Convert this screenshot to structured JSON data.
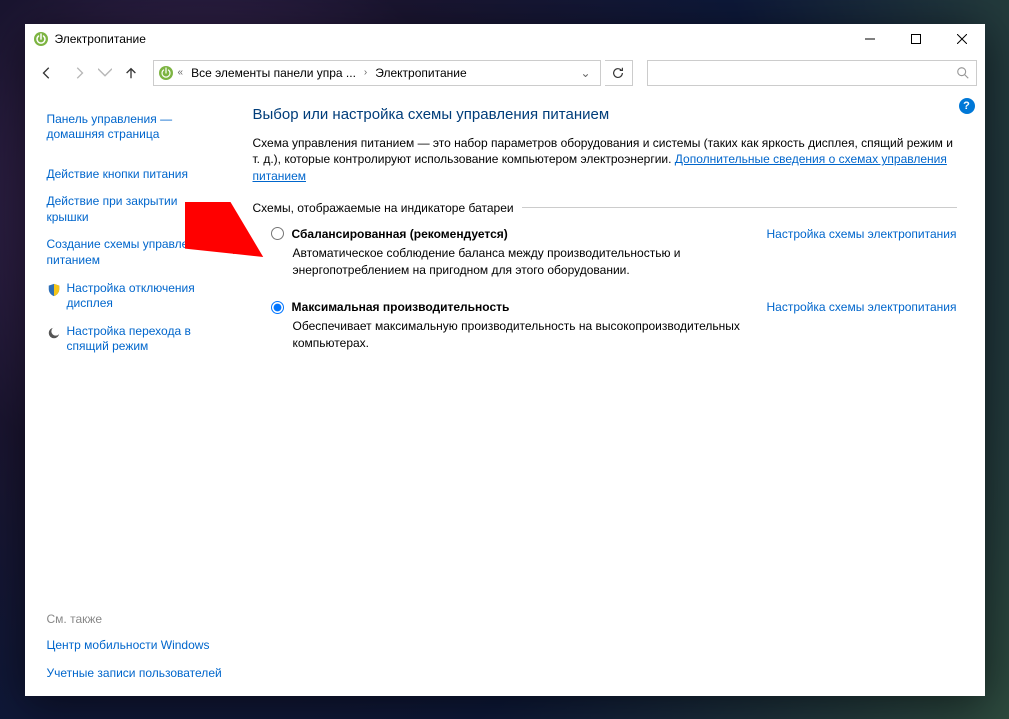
{
  "window": {
    "title": "Электропитание"
  },
  "breadcrumb": {
    "root": "Все элементы панели упра ...",
    "current": "Электропитание"
  },
  "search": {
    "placeholder": ""
  },
  "sidebar": {
    "home": "Панель управления — домашняя страница",
    "items": [
      "Действие кнопки питания",
      "Действие при закрытии крышки",
      "Создание схемы управления питанием",
      "Настройка отключения дисплея",
      "Настройка перехода в спящий режим"
    ],
    "see_also_header": "См. также",
    "see_also": [
      "Центр мобильности Windows",
      "Учетные записи пользователей"
    ]
  },
  "main": {
    "heading": "Выбор или настройка схемы управления питанием",
    "intro": "Схема управления питанием — это набор параметров оборудования и системы (таких как яркость дисплея, спящий режим и т. д.), которые контролируют использование компьютером электроэнергии. ",
    "intro_link": "Дополнительные сведения о схемах управления питанием",
    "fieldset": "Схемы, отображаемые на индикаторе батареи",
    "plans": [
      {
        "label": "Сбалансированная (рекомендуется)",
        "desc": "Автоматическое соблюдение баланса между производительностью и энергопотреблением на пригодном для этого оборудовании.",
        "settings_link": "Настройка схемы электропитания",
        "checked": false
      },
      {
        "label": "Максимальная производительность",
        "desc": "Обеспечивает максимальную производительность на высокопроизводительных компьютерах.",
        "settings_link": "Настройка схемы электропитания",
        "checked": true
      }
    ]
  },
  "help": "?"
}
